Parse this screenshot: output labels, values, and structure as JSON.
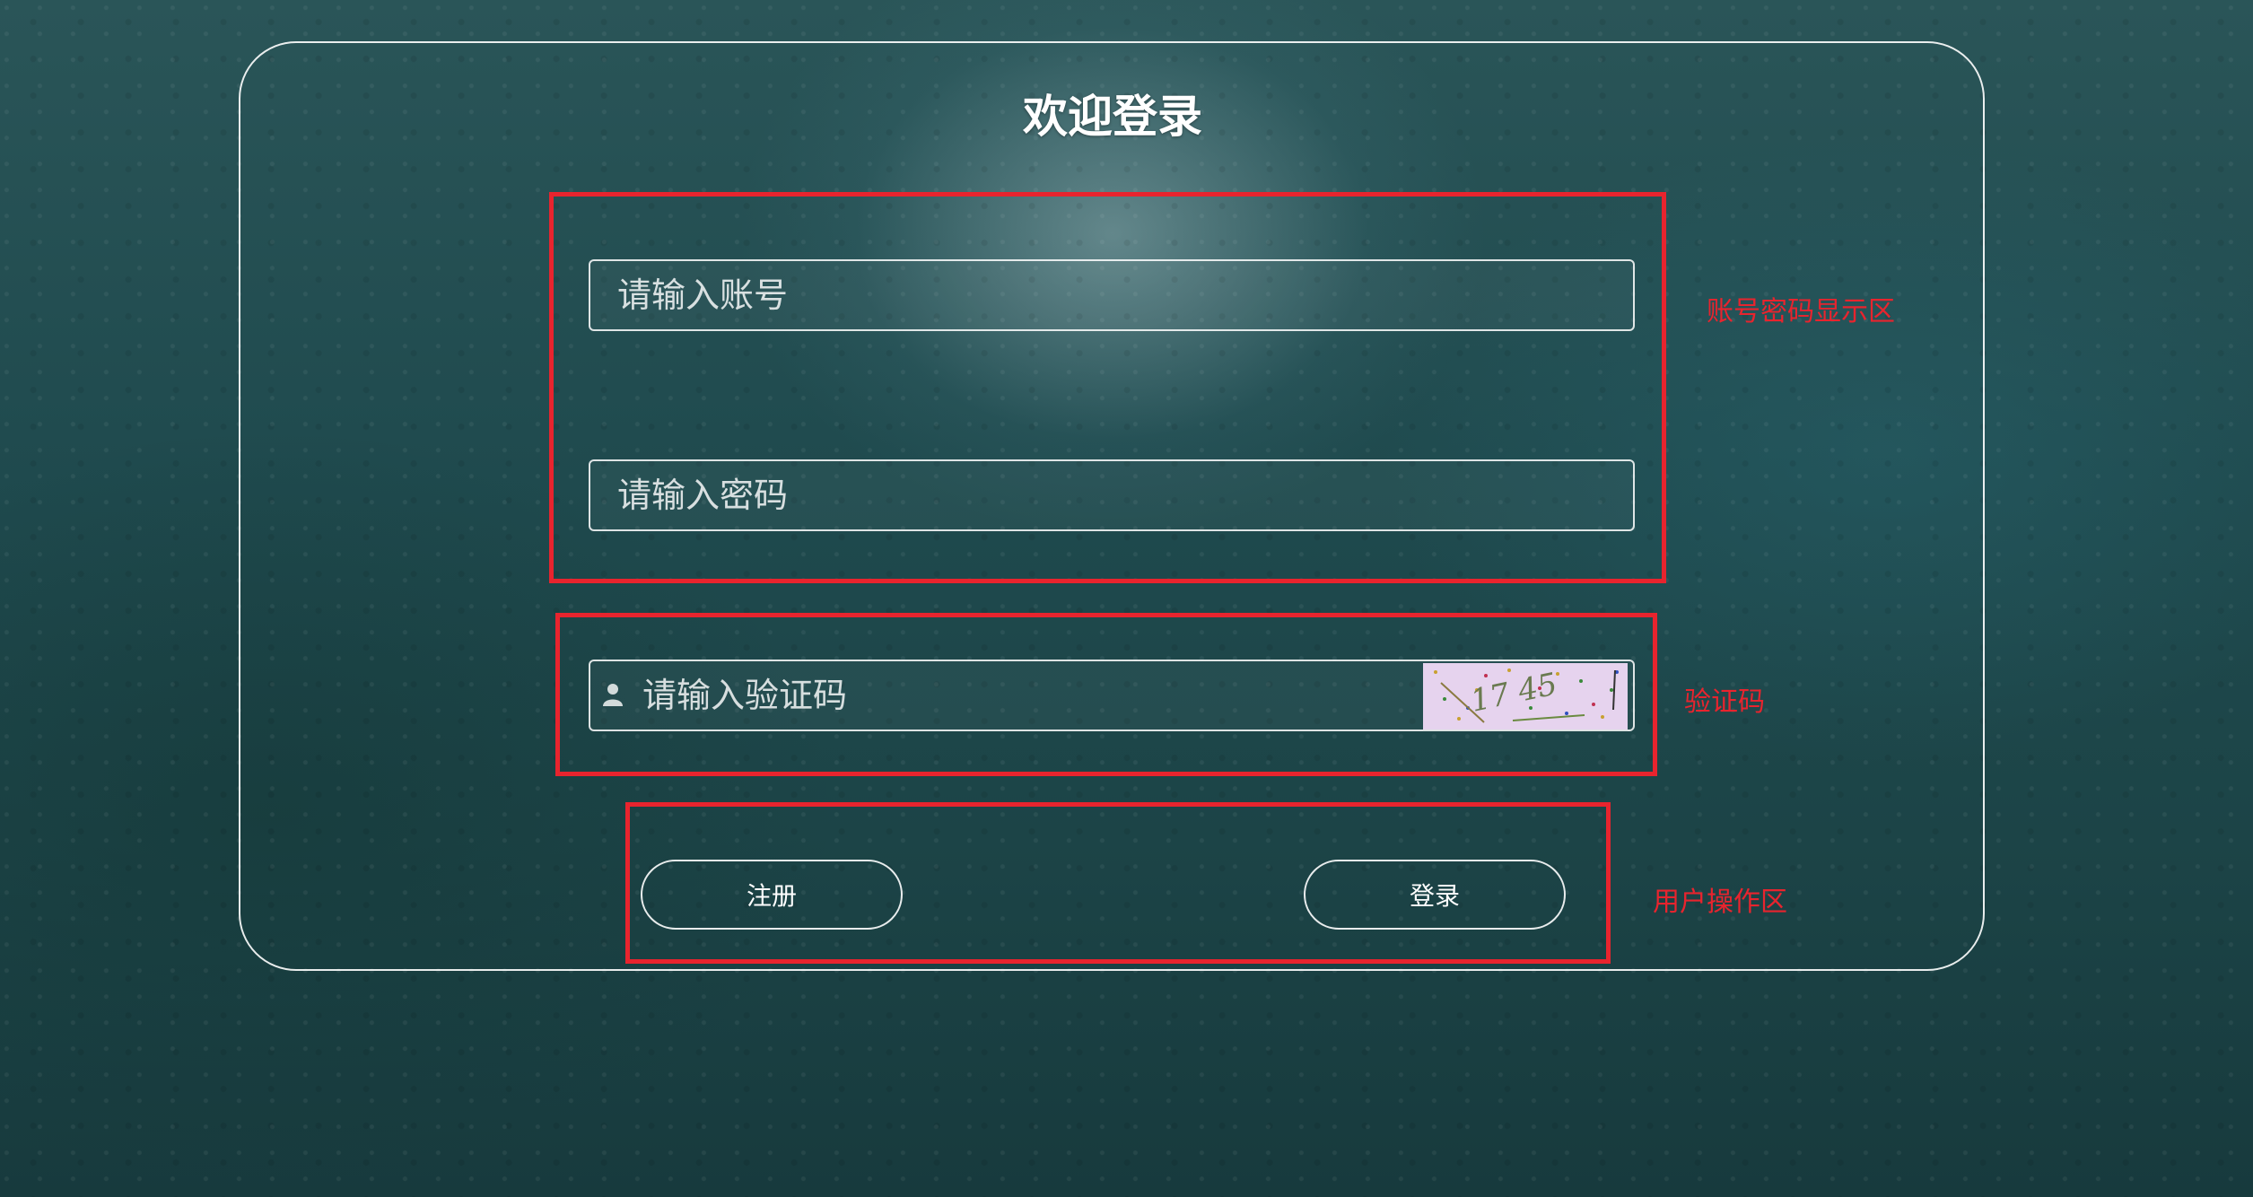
{
  "page": {
    "title": "欢迎登录"
  },
  "form": {
    "account": {
      "placeholder": "请输入账号",
      "value": ""
    },
    "password": {
      "placeholder": "请输入密码",
      "value": ""
    },
    "captcha": {
      "placeholder": "请输入验证码",
      "value": "",
      "image_text": "17 45"
    }
  },
  "actions": {
    "register_label": "注册",
    "login_label": "登录"
  },
  "annotations": {
    "credentials": "账号密码显示区",
    "captcha": "验证码",
    "operations": "用户操作区"
  },
  "colors": {
    "annotation_red": "#e8242e",
    "border_white": "#ffffff",
    "captcha_bg": "#e6d3ee"
  },
  "icons": {
    "captcha_field_icon": "user-icon"
  }
}
